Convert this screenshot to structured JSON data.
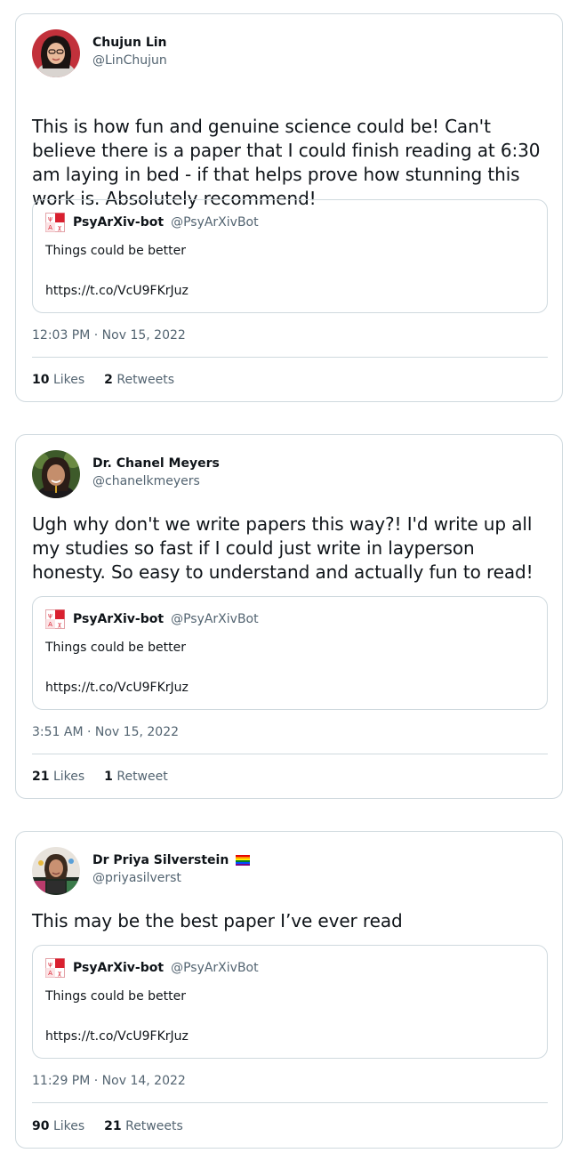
{
  "tweets": [
    {
      "display_name": "Chujun Lin",
      "handle": "@LinChujun",
      "text": "This is how fun and genuine science could be! Can't believe there is a paper that I could finish reading at 6:30 am laying in bed - if that helps prove how stunning this work is. Absolutely recommend!",
      "quote": {
        "name": "PsyArXiv-bot",
        "handle": "@PsyArXivBot",
        "body": "Things could be better",
        "link": "https://t.co/VcU9FKrJuz"
      },
      "timestamp": "12:03 PM · Nov 15, 2022",
      "likes_count": "10",
      "likes_label": "Likes",
      "retweets_count": "2",
      "retweets_label": "Retweets"
    },
    {
      "display_name": "Dr. Chanel Meyers",
      "handle": "@chanelkmeyers",
      "text": "Ugh why don't we write papers this way?! I'd write up all my studies so fast if I could just write in layperson honesty. So easy to understand and actually fun to read!",
      "quote": {
        "name": "PsyArXiv-bot",
        "handle": "@PsyArXivBot",
        "body": "Things could be better",
        "link": "https://t.co/VcU9FKrJuz"
      },
      "timestamp": "3:51 AM · Nov 15, 2022",
      "likes_count": "21",
      "likes_label": "Likes",
      "retweets_count": "1",
      "retweets_label": "Retweet"
    },
    {
      "display_name": "Dr Priya Silverstein",
      "name_icon": "rainbow-flag-icon",
      "handle": "@priyasilverst",
      "text": "This may be the best paper I’ve ever read",
      "quote": {
        "name": "PsyArXiv-bot",
        "handle": "@PsyArXivBot",
        "body": "Things could be better",
        "link": "https://t.co/VcU9FKrJuz"
      },
      "timestamp": "11:29 PM · Nov 14, 2022",
      "likes_count": "90",
      "likes_label": "Likes",
      "retweets_count": "21",
      "retweets_label": "Retweets"
    }
  ],
  "colors": {
    "text_primary": "#0f1419",
    "text_secondary": "#536471",
    "border": "#cfd9de",
    "bot_logo_red": "#d9202f"
  }
}
